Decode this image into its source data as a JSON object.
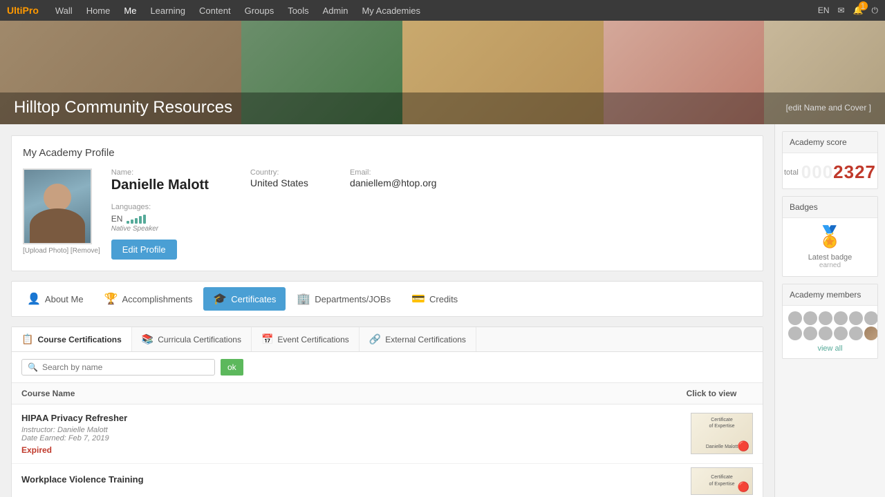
{
  "nav": {
    "logo": "UltiPro",
    "items": [
      "Wall",
      "Home",
      "Me",
      "Learning",
      "Content",
      "Groups",
      "Tools",
      "Admin",
      "My Academies"
    ],
    "active": "Me",
    "lang": "EN"
  },
  "hero": {
    "title": "Hilltop Community Resources",
    "edit_label": "[edit Name and Cover ]"
  },
  "profile": {
    "title": "My Academy Profile",
    "name_label": "Name:",
    "name": "Danielle Malott",
    "country_label": "Country:",
    "country": "United States",
    "email_label": "Email:",
    "email": "daniellem@htop.org",
    "languages_label": "Languages:",
    "lang_code": "EN",
    "lang_desc": "Native Speaker",
    "photo_links": "[Upload Photo] [Remove]",
    "edit_btn": "Edit Profile"
  },
  "tabs": [
    {
      "id": "about",
      "label": "About Me",
      "icon": "👤"
    },
    {
      "id": "accomplishments",
      "label": "Accomplishments",
      "icon": "🏆"
    },
    {
      "id": "certificates",
      "label": "Certificates",
      "icon": "🎓",
      "active": true
    },
    {
      "id": "departments",
      "label": "Departments/JOBs",
      "icon": "🏢"
    },
    {
      "id": "credits",
      "label": "Credits",
      "icon": "💳"
    }
  ],
  "cert_tabs": [
    {
      "id": "course",
      "label": "Course Certifications",
      "icon": "📋",
      "active": true
    },
    {
      "id": "curricula",
      "label": "Curricula Certifications",
      "icon": "📚"
    },
    {
      "id": "event",
      "label": "Event Certifications",
      "icon": "📅"
    },
    {
      "id": "external",
      "label": "External Certifications",
      "icon": "🔗"
    }
  ],
  "search": {
    "placeholder": "Search by name",
    "ok_label": "ok"
  },
  "table": {
    "col_name": "Course Name",
    "col_view": "Click to view",
    "rows": [
      {
        "id": "row1",
        "name": "HIPAA Privacy Refresher",
        "instructor": "Instructor: Danielle Malott",
        "date": "Date Earned: Feb 7, 2019",
        "status": "Expired"
      },
      {
        "id": "row2",
        "name": "Workplace Violence Training",
        "instructor": "",
        "date": "",
        "status": ""
      }
    ]
  },
  "sidebar": {
    "academy_score": {
      "title": "Academy score",
      "total_label": "total",
      "score_prefix": "000",
      "score_main": "2327"
    },
    "badges": {
      "title": "Badges",
      "latest_label": "Latest badge",
      "earned_label": "earned"
    },
    "members": {
      "title": "Academy members",
      "view_all": "view all"
    }
  }
}
